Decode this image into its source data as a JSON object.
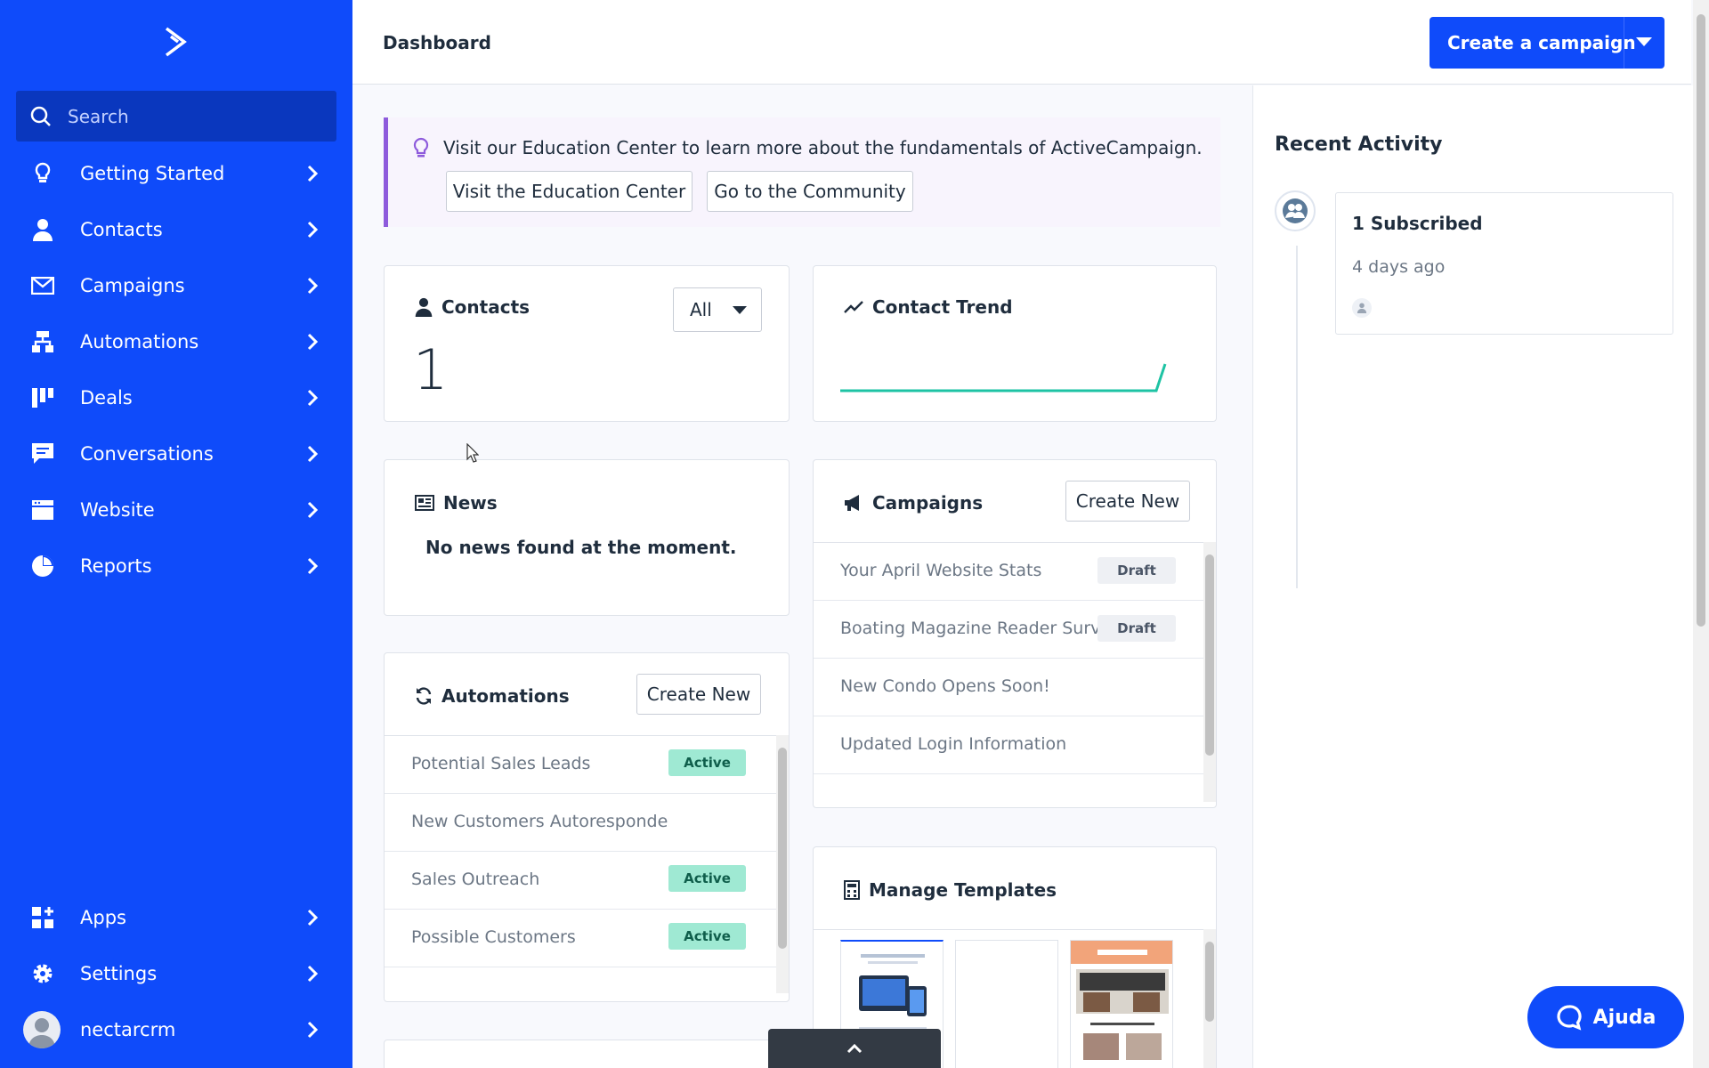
{
  "sidebar": {
    "search_placeholder": "Search",
    "items": [
      {
        "label": "Getting Started",
        "icon": "lightbulb-icon"
      },
      {
        "label": "Contacts",
        "icon": "person-icon"
      },
      {
        "label": "Campaigns",
        "icon": "envelope-icon"
      },
      {
        "label": "Automations",
        "icon": "automation-icon"
      },
      {
        "label": "Deals",
        "icon": "pipeline-icon"
      },
      {
        "label": "Conversations",
        "icon": "chat-icon"
      },
      {
        "label": "Website",
        "icon": "website-icon"
      },
      {
        "label": "Reports",
        "icon": "pie-chart-icon"
      }
    ],
    "bottom_items": [
      {
        "label": "Apps",
        "icon": "apps-icon"
      },
      {
        "label": "Settings",
        "icon": "gear-icon"
      },
      {
        "label": "nectarcrm",
        "icon": "avatar"
      }
    ]
  },
  "header": {
    "title": "Dashboard",
    "create_campaign_label": "Create a campaign"
  },
  "banner": {
    "text": "Visit our Education Center to learn more about the fundamentals of ActiveCampaign.",
    "button_education": "Visit the Education Center",
    "button_community": "Go to the Community"
  },
  "contacts_card": {
    "title": "Contacts",
    "count": "1",
    "filter_value": "All"
  },
  "trend_card": {
    "title": "Contact Trend"
  },
  "news_card": {
    "title": "News",
    "empty_text": "No news found at the moment."
  },
  "campaigns_card": {
    "title": "Campaigns",
    "create_label": "Create New",
    "rows": [
      {
        "name": "Your April Website Stats",
        "status": "Draft"
      },
      {
        "name": "Boating Magazine Reader Survey",
        "status": "Draft"
      },
      {
        "name": "New Condo Opens Soon!",
        "status": ""
      },
      {
        "name": "Updated Login Information",
        "status": ""
      }
    ]
  },
  "automations_card": {
    "title": "Automations",
    "create_label": "Create New",
    "rows": [
      {
        "name": "Potential Sales Leads",
        "status": "Active"
      },
      {
        "name": "New Customers Autoresponder",
        "status": ""
      },
      {
        "name": "Sales Outreach",
        "status": "Active"
      },
      {
        "name": "Possible Customers",
        "status": "Active"
      }
    ]
  },
  "templates_card": {
    "title": "Manage Templates"
  },
  "recent_activity": {
    "title": "Recent Activity",
    "item_title": "1 Subscribed",
    "item_time": "4 days ago"
  },
  "help": {
    "label": "Ajuda"
  },
  "colors": {
    "brand_blue": "#0f4bfa",
    "active_badge": "#9fe9d3",
    "banner_accent": "#8e5bdc",
    "trend_line": "#1ec3a4"
  }
}
